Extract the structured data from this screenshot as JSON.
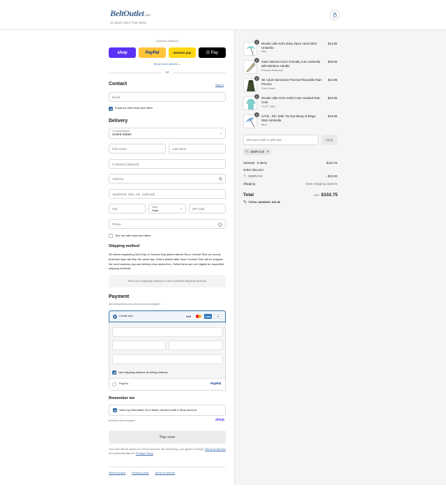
{
  "store": {
    "name": "BeltOutlet",
    "domain_suffix": ".com",
    "tagline": "So Much More Than Belts"
  },
  "express": {
    "title": "Express checkout",
    "shop_label": "shop",
    "paypal_label": "PayPal",
    "amazon_label": "amazon pay",
    "gpay_label": "G Pay",
    "more_label": "Show more options",
    "or_label": "OR"
  },
  "contact": {
    "title": "Contact",
    "signin": "Sign in",
    "email_placeholder": "Email",
    "email_news": "Email me with news and offers"
  },
  "delivery": {
    "title": "Delivery",
    "country_label": "Country/Region",
    "country_value": "United States",
    "first_name": "First name",
    "last_name": "Last name",
    "company": "Company (optional)",
    "address": "Address",
    "apartment": "Apartment, suite, etc. (optional)",
    "city": "City",
    "state_label": "State",
    "state_value": "State",
    "zip": "ZIP code",
    "phone": "Phone",
    "text_news": "Text me with news and offers"
  },
  "shipping": {
    "title": "Shipping method",
    "notice": "All orders requesting Next Day or Second Day placed before Noon Central Time on normal business days will ship the same day. Orders placed after Noon Central Time will be shipped the next business day and delivery time starts then. Select items are not eligible for expedited shipping methods.",
    "placeholder": "Enter your shipping address to view available shipping methods"
  },
  "payment": {
    "title": "Payment",
    "subtitle": "All transactions are secure and encrypted.",
    "credit_card": "Credit card",
    "card_brands": [
      "VISA",
      "MC",
      "AMEX"
    ],
    "more_brands": "+5",
    "billing_same": "Use shipping address as billing address",
    "paypal_option": "PayPal",
    "paypal_logo": "PayPal"
  },
  "remember": {
    "title": "Remember me",
    "save_info": "Save my information for a faster checkout with a Shop account",
    "secure": "Secure and encrypted",
    "shop_logo": "shop"
  },
  "pay_button": "Pay now",
  "legal": {
    "prefix": "Your info will be saved to a Shop account. By continuing, you agree to Shop's",
    "terms": "Terms of Service",
    "middle": "and acknowledge the",
    "privacy": "Privacy Policy",
    "end": "."
  },
  "footer": {
    "refund": "Refund policy",
    "privacy": "Privacy policy",
    "terms": "Terms of service"
  },
  "cart": {
    "items": [
      {
        "qty": "1",
        "name": "Woolie Little Kid's Easy Open Hook Stick Umbrella",
        "variant": "Mint",
        "price": "$13.95",
        "icon": "umbrella-mint-icon",
        "color": "#8fd3cf"
      },
      {
        "qty": "1",
        "name": "Totes Women's Eco Friendly Auto Umbrella with Bamboo Handle",
        "variant": "Pressed Botanical",
        "price": "$28.95",
        "icon": "umbrella-bamboo-icon",
        "color": "#b9b3a3"
      },
      {
        "qty": "1",
        "name": "SE Adult Aluminized Thermal Reusable Rain Poncho",
        "variant": "Olive Green",
        "price": "$13.95",
        "icon": "poncho-icon",
        "color": "#3e4a2c"
      },
      {
        "qty": "1",
        "name": "Woolie Little Girl's Solid Color Hooded Rain Coat",
        "variant": "2T/3T / Mint",
        "price": "$33.95",
        "icon": "raincoat-icon",
        "color": "#7fcfcb"
      },
      {
        "qty": "1",
        "name": "U.P.D., INC Kids' Tie Dye Bluey & Bingo Stick Umbrella",
        "variant": "Blue",
        "price": "$15.95",
        "icon": "umbrella-bluey-icon",
        "color": "#8fb6dc"
      }
    ],
    "discount_placeholder": "Discount code or gift card",
    "apply": "Apply",
    "code_chip": "SIMPLY10",
    "subtotal_label": "Subtotal · 5 items",
    "subtotal_value": "$112.75",
    "order_discount_label": "Order discount",
    "discount_code": "SIMPLY10",
    "discount_value": "– $10.00",
    "shipping_label": "Shipping",
    "shipping_value": "Enter shipping address",
    "total_label": "Total",
    "currency": "USD",
    "total_value": "$102.75",
    "savings_label": "TOTAL SAVINGS",
    "savings_value": "$10.00"
  }
}
